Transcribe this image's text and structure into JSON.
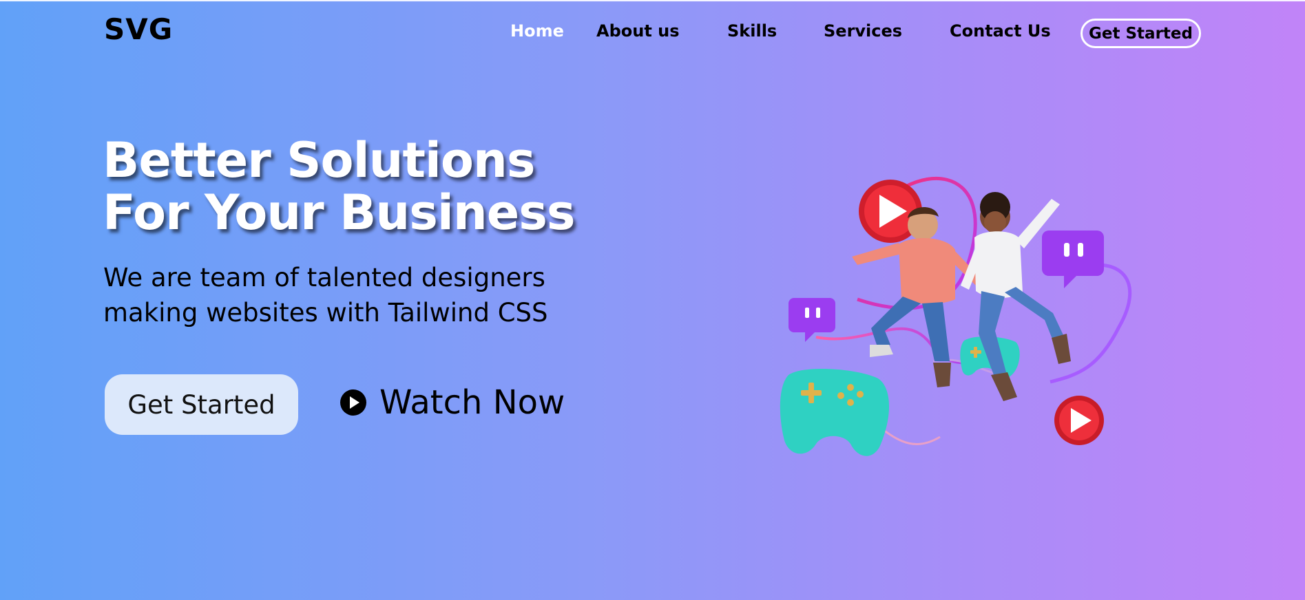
{
  "brand": {
    "logo": "SVG"
  },
  "nav": {
    "items": [
      {
        "label": "Home",
        "active": true
      },
      {
        "label": "About us",
        "active": false
      },
      {
        "label": "Skills",
        "active": false
      },
      {
        "label": "Services",
        "active": false
      },
      {
        "label": "Contact Us",
        "active": false
      }
    ],
    "cta_label": "Get Started"
  },
  "hero": {
    "title_line1": "Better Solutions",
    "title_line2": "For Your Business",
    "subtitle_line1": "We are team of talented designers",
    "subtitle_line2": "making websites with Tailwind CSS",
    "primary_cta_label": "Get Started",
    "secondary_cta_label": "Watch Now",
    "secondary_cta_icon": "play-circle-icon"
  },
  "illustration": {
    "icons": [
      "play-button-icon",
      "twitch-icon",
      "gamepad-icon"
    ]
  },
  "colors": {
    "gradient_start": "#61a1f8",
    "gradient_end": "#c184f8",
    "primary_cta_bg": "#dce8fb",
    "active_nav": "#ffffff"
  }
}
